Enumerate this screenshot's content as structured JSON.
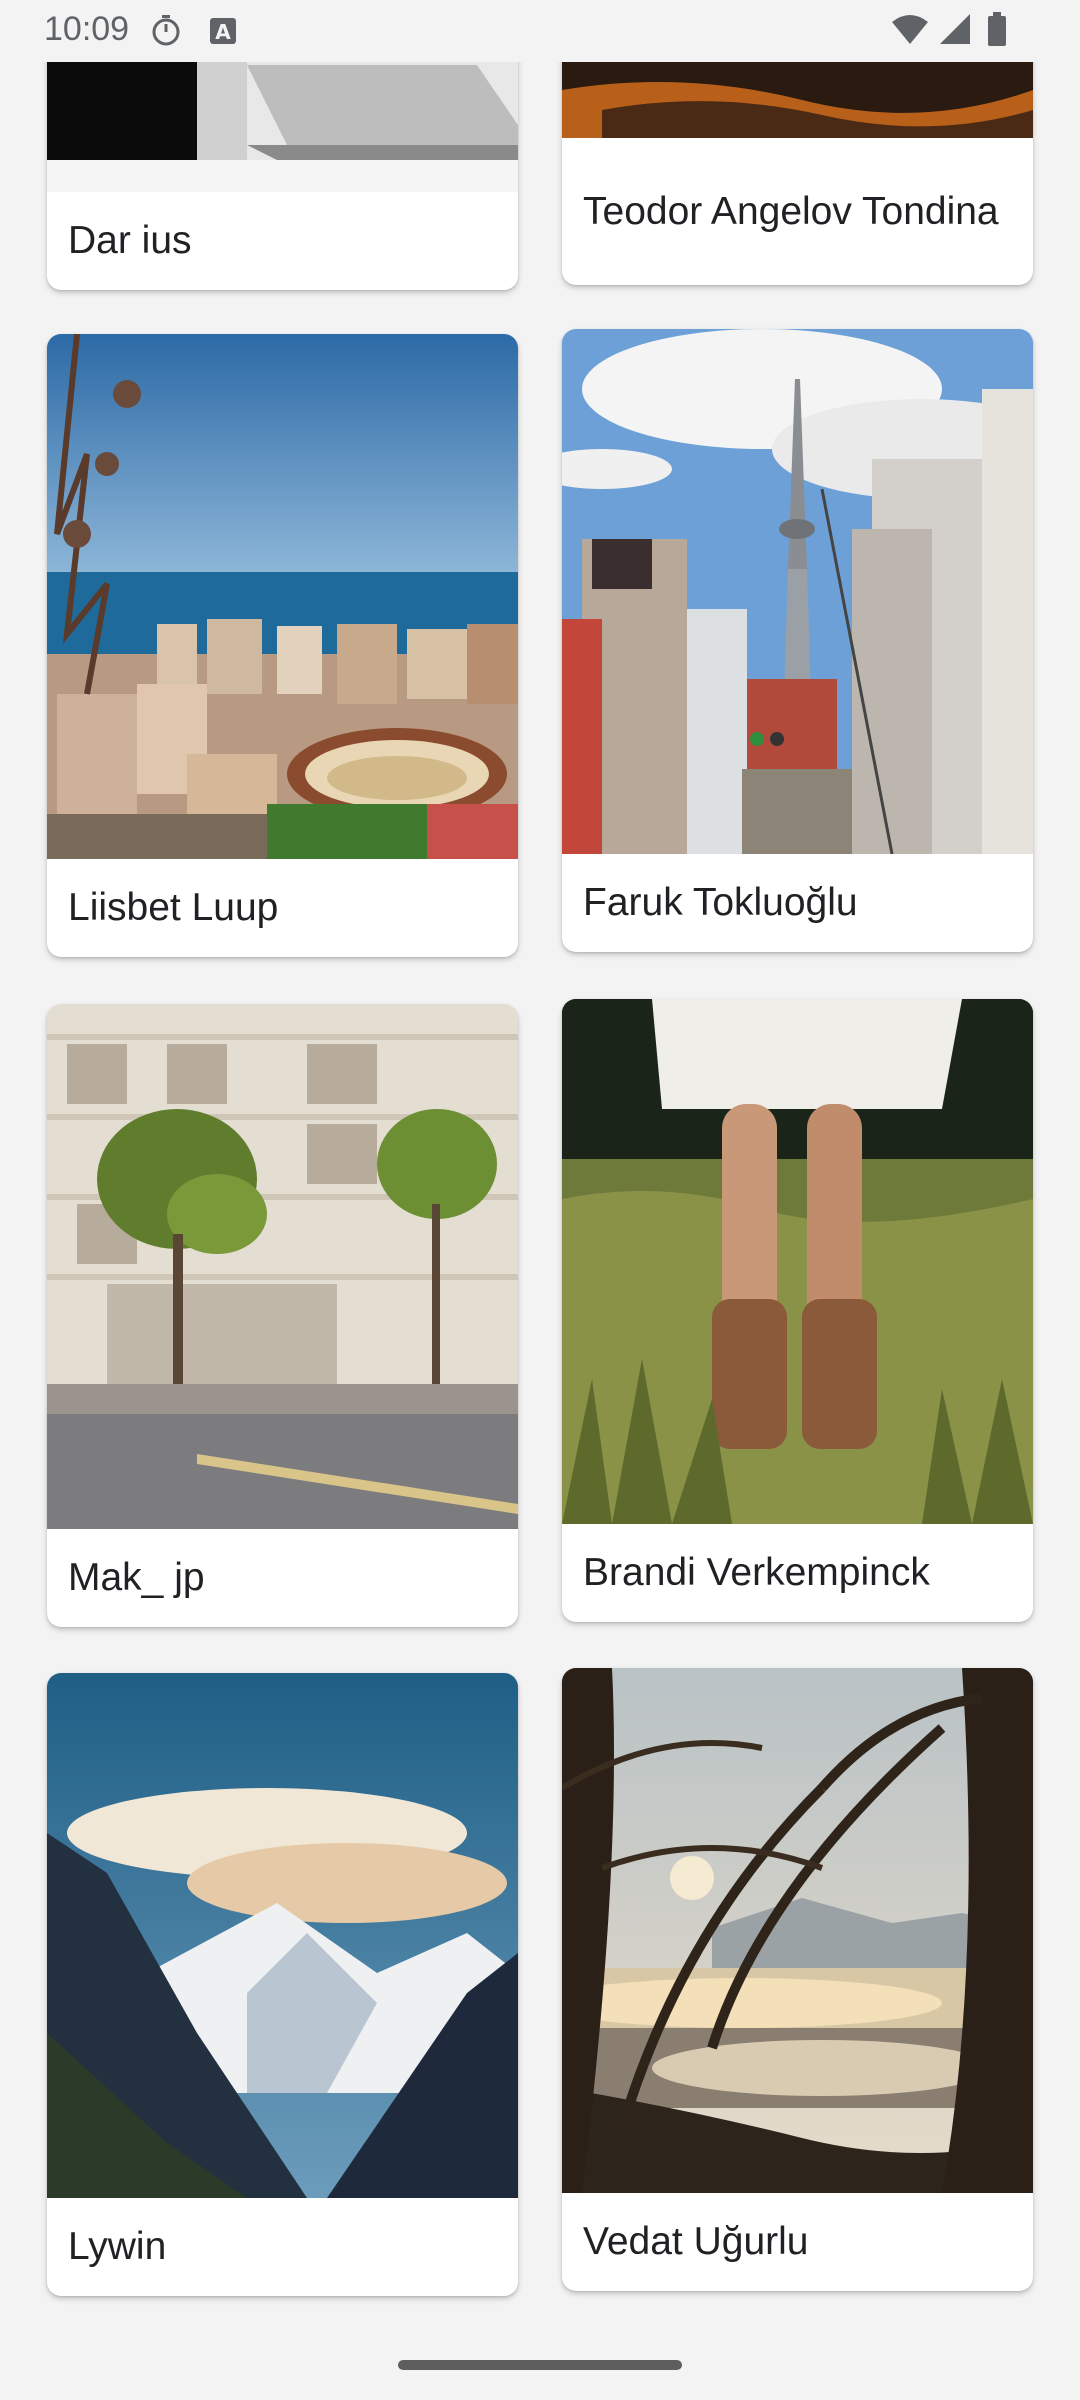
{
  "status_bar": {
    "time": "10:09",
    "icons": [
      "stopwatch-icon",
      "a-box-icon",
      "wifi-icon",
      "cell-signal-icon",
      "battery-icon"
    ]
  },
  "gallery": {
    "items": [
      {
        "name": "Dar ius",
        "photo": "white building overhang"
      },
      {
        "name": "Teodor Angelov Tondina",
        "photo": "sunset landscape"
      },
      {
        "name": "Liisbet Luup",
        "photo": "coastal city with bullring"
      },
      {
        "name": "Faruk Tokluoğlu",
        "photo": "tokyo street with tower"
      },
      {
        "name": "Mak_ jp",
        "photo": "building with trees"
      },
      {
        "name": "Brandi Verkempinck",
        "photo": "woman in grass field"
      },
      {
        "name": "Lywin",
        "photo": "snowy mountain valley"
      },
      {
        "name": "Vedat Uğurlu",
        "photo": "misty lake with trees"
      }
    ]
  },
  "colors": {
    "background": "#f3f3f3",
    "card": "#ffffff",
    "text": "#202124"
  }
}
